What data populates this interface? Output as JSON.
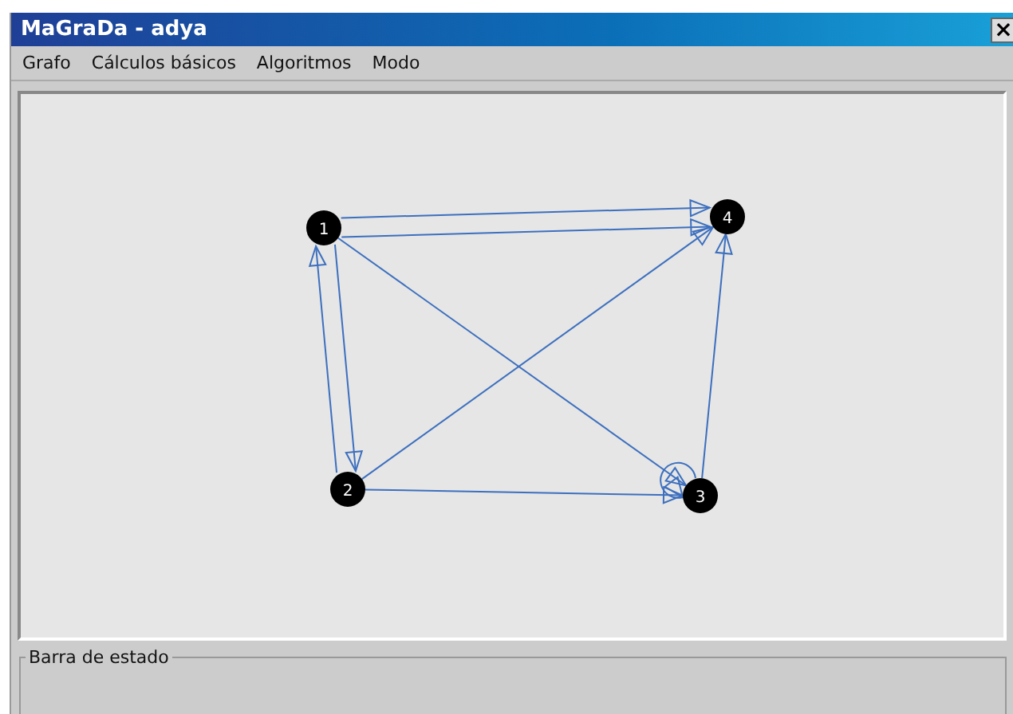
{
  "window": {
    "title": "MaGraDa - adya",
    "close": "×"
  },
  "menu": [
    "Grafo",
    "Cálculos básicos",
    "Algoritmos",
    "Modo"
  ],
  "graph": {
    "nodes": [
      "1",
      "2",
      "3",
      "4"
    ]
  },
  "status_bar": {
    "title": "Barra de estado"
  }
}
